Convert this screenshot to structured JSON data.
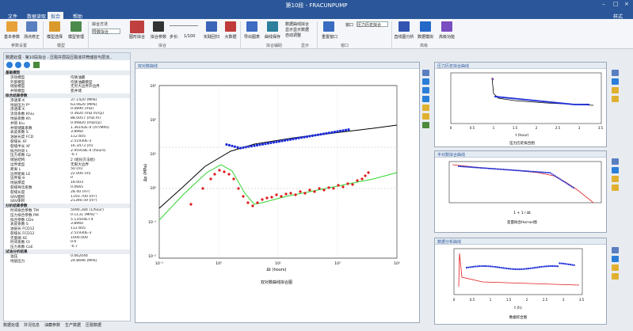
{
  "app": {
    "title": "第10段 - FRACUNPUMP",
    "top_right": "样式"
  },
  "menu": [
    "文件",
    "数据读取",
    "拟合",
    "帮助"
  ],
  "ribbon": {
    "buttons": [
      "基本参数",
      "测点修正",
      "模型选择",
      "模型管理",
      "图形拟合",
      "拟合参数",
      "实践回归",
      "大数据",
      "导出图表",
      "曲线保存",
      "平方拟合",
      "曲线对比",
      "重置窗口",
      "直线图分析",
      "数据模拟",
      "高级功能"
    ],
    "combo1_label": "拟合方法",
    "combo1_value": "导数拟合",
    "scale_label": "1/100",
    "step_label": "步长:",
    "checks": [
      "数据曲线拟合",
      "显示显示数据",
      "自动调整"
    ],
    "window_label": "窗口",
    "window_value": "压力历史拟合",
    "groups": [
      "参数设置",
      "模型",
      "拟合",
      "拟合辅助",
      "显示",
      "窗口",
      "高级"
    ]
  },
  "left": {
    "tab": "数据处理",
    "path": "第10段拟合 - 压裂井层段压裂液井筒储容与层流.."
  },
  "rows": [
    {
      "sec": 1,
      "k": "基础模型"
    },
    {
      "k": "流动模型",
      "v": "均质油藏"
    },
    {
      "k": "外部模型",
      "v": "均质油藏模型"
    },
    {
      "k": "储层模型",
      "v": "无穷大边界外边界"
    },
    {
      "k": "井筒模型",
      "v": "变井储"
    },
    {
      "sec": 1,
      "k": "拟合结果参数"
    },
    {
      "k": "渗透率 K",
      "v": "37.1420 (MPa)"
    },
    {
      "k": "地层压力 P*",
      "v": "63.0620 (MPa)"
    },
    {
      "k": "渗透率 K",
      "v": "0.0890 (mD)"
    },
    {
      "k": "流动系数 Kh/u",
      "v": "0.3920 (mD.m/cp)"
    },
    {
      "k": "地层系数 Kh",
      "v": "88.0057 (mD.m)"
    },
    {
      "k": "井筒 K/u",
      "v": "0.09820 (mD/cp)"
    },
    {
      "k": "井筒储集系数",
      "v": "1.36192E-4 (m³/MPa)"
    },
    {
      "k": "表皮系数 S",
      "v": "3.8960"
    },
    {
      "k": "油层长度 FCD",
      "v": "112.605"
    },
    {
      "k": "裂缝长 XF",
      "v": "2.51930E-3"
    },
    {
      "k": "裂缝半长 Xf",
      "v": "16.3473 (m)"
    },
    {
      "k": "拟合时间 t",
      "v": "2.95918E-4 (hours)"
    },
    {
      "k": "压力系数 Cp",
      "v": "-0.7"
    },
    {
      "k": "储层结构",
      "v": "2 (组份方法组)"
    },
    {
      "k": "边界类型",
      "v": "无限大边界"
    },
    {
      "k": "距离 L",
      "v": "50 (m)"
    },
    {
      "k": "边界距离 LE",
      "v": "22.000 (m)"
    },
    {
      "k": "边界角 θ",
      "v": "0"
    },
    {
      "k": "地层厚度",
      "v": "18.003"
    },
    {
      "k": "裂缝导流系数",
      "v": "0.0665"
    },
    {
      "k": "裂缝长度",
      "v": "28.40 (m²)"
    },
    {
      "k": "SRV面积",
      "v": "1193.700 (m²)"
    },
    {
      "k": "SRV体积",
      "v": "21390.59 (m³)"
    },
    {
      "sec": 1,
      "k": "分析结果参数"
    },
    {
      "k": "时间拟合参数 TM",
      "v": "5090.284 (1/hour)"
    },
    {
      "k": "压力拟合参数 PM",
      "v": "0.1131 (MPa)⁻¹"
    },
    {
      "k": "拟合参数 CDe",
      "v": "5.13504E+4"
    },
    {
      "k": "表皮系数 S",
      "v": "3.8960"
    },
    {
      "k": "油层长 FCD12",
      "v": "112.605"
    },
    {
      "k": "裂缝长 FCD12",
      "v": "2.51930E-3"
    },
    {
      "k": "无量纲 XE",
      "v": "1000.000"
    },
    {
      "k": "时间系数 Ct",
      "v": "0.6"
    },
    {
      "k": "压力系数 CoE",
      "v": "-0.7"
    },
    {
      "sec": 1,
      "k": "试油分析结果"
    },
    {
      "k": "油压",
      "v": "0.062044"
    },
    {
      "k": "地层压力",
      "v": "24.8696 (MPa)"
    }
  ],
  "bottom_tabs": [
    "数据处理",
    "井况信息",
    "油藏参数",
    "生产数据",
    "压裂数据"
  ],
  "windows": {
    "main": "双对数曲线",
    "top": "压力历史拟合曲线",
    "middle": "半对数拟合曲线",
    "bottom": "数据分析曲线"
  },
  "main_plot": {
    "xlabel": "Δt (hours)",
    "caption": "双对数曲线拟合图",
    "ylabel": "Δp (MPa)",
    "xticks": [
      "10⁻¹",
      "10⁰",
      "10¹",
      "10²",
      "10³"
    ],
    "yticks": [
      "10³",
      "10²",
      "10¹",
      "10⁰",
      "10⁻¹",
      "10⁻²"
    ]
  },
  "top_plot": {
    "xlabel": "t (hour)",
    "caption": "压力历史拟合图",
    "xticks": [
      "0",
      "0.5",
      "1",
      "1.5",
      "2",
      "2.5",
      "3",
      "3.5"
    ]
  },
  "middle_plot": {
    "xlabel": "1 + 1 / Δt",
    "caption": "变量拟合Horner图"
  },
  "bottom_plot": {
    "xlabel": "t (h)",
    "caption": "数据综合图",
    "xticks": [
      "0",
      "0.5",
      "1",
      "1.5",
      "2",
      "2.5",
      "3",
      "3.5"
    ]
  },
  "colors": {
    "accent": "#2b579a",
    "series_blue": "#1a2bd6",
    "series_red": "#e01818",
    "fit_black": "#000000",
    "fit_green": "#2fd62f"
  }
}
